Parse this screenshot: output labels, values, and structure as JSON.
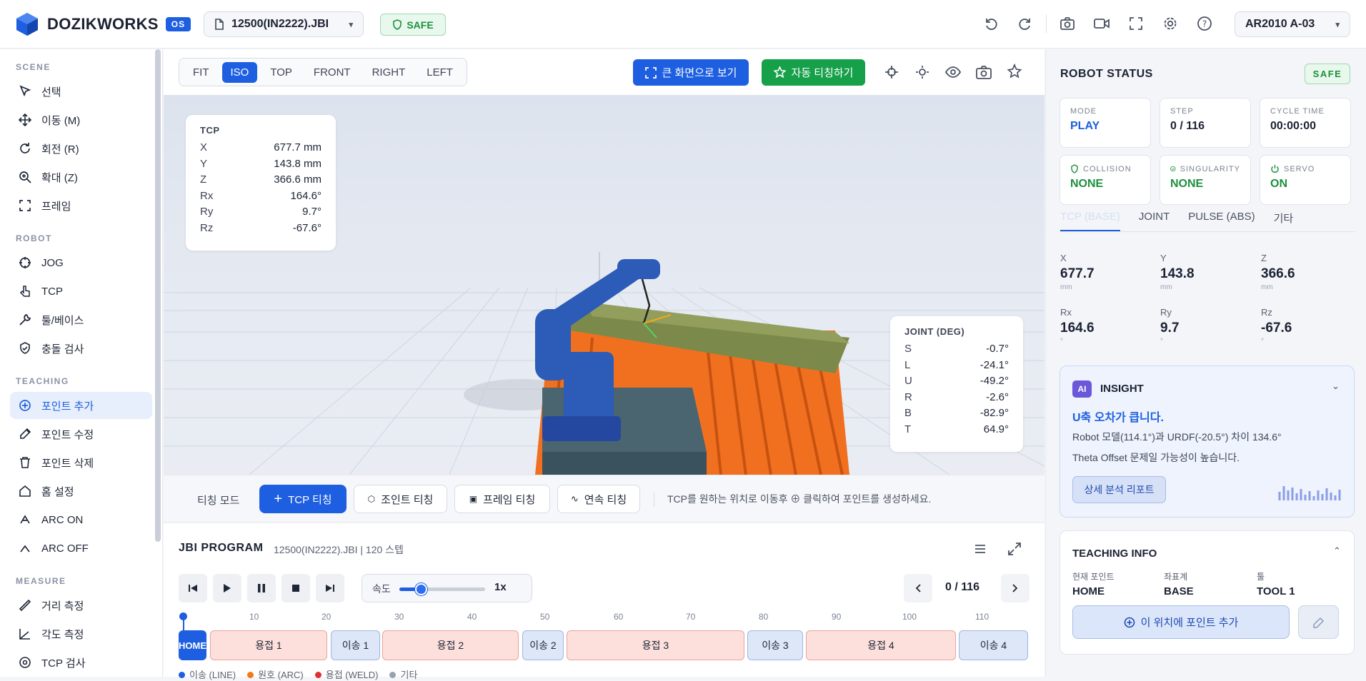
{
  "app": {
    "logo_text": "DOZIKWORKS",
    "os_badge": "OS",
    "file": "12500(IN2222).JBI",
    "safe": "SAFE",
    "robot": "AR2010 A-03"
  },
  "sidebar": {
    "scene_label": "SCENE",
    "scene": [
      "선택",
      "이동 (M)",
      "회전 (R)",
      "확대 (Z)",
      "프레임"
    ],
    "robot_label": "ROBOT",
    "robot": [
      "JOG",
      "TCP",
      "툴/베이스",
      "충돌 검사"
    ],
    "teaching_label": "TEACHING",
    "teaching": [
      "포인트 추가",
      "포인트 수정",
      "포인트 삭제",
      "홈 설정",
      "ARC ON",
      "ARC OFF"
    ],
    "measure_label": "MEASURE",
    "measure": [
      "거리 측정",
      "각도 측정",
      "TCP 검사"
    ]
  },
  "viewbar": {
    "tabs": [
      "FIT",
      "ISO",
      "TOP",
      "FRONT",
      "RIGHT",
      "LEFT"
    ],
    "active_tab": "ISO",
    "big_view": "큰 화면으로 보기",
    "auto_teach": "자동 티칭하기"
  },
  "tcp_panel": {
    "title": "TCP",
    "rows": [
      {
        "k": "X",
        "v": "677.7 mm"
      },
      {
        "k": "Y",
        "v": "143.8 mm"
      },
      {
        "k": "Z",
        "v": "366.6 mm"
      },
      {
        "k": "Rx",
        "v": "164.6°"
      },
      {
        "k": "Ry",
        "v": "9.7°"
      },
      {
        "k": "Rz",
        "v": "-67.6°"
      }
    ]
  },
  "joint_panel": {
    "title": "JOINT (DEG)",
    "rows": [
      {
        "k": "S",
        "v": "-0.7°"
      },
      {
        "k": "L",
        "v": "-24.1°"
      },
      {
        "k": "U",
        "v": "-49.2°"
      },
      {
        "k": "R",
        "v": "-2.6°"
      },
      {
        "k": "B",
        "v": "-82.9°"
      },
      {
        "k": "T",
        "v": "64.9°"
      }
    ]
  },
  "teachbar": {
    "mode_label": "티칭 모드",
    "tcp": "TCP 티칭",
    "joint": "조인트 티칭",
    "frame": "프레임 티칭",
    "continuous": "연속 티칭",
    "hint": "TCP를 원하는 위치로 이동후 ⊕ 클릭하여 포인트를 생성하세요."
  },
  "program": {
    "title": "JBI PROGRAM",
    "subtitle": "12500(IN2222).JBI | 120 스텝",
    "speed_label": "속도",
    "speed_value": "1x",
    "speed_fraction": 0.25,
    "step": "0 / 116",
    "ticks": [
      "10",
      "20",
      "30",
      "40",
      "50",
      "60",
      "70",
      "80",
      "90",
      "100",
      "110"
    ],
    "segments": [
      {
        "label": "HOME",
        "type": "home"
      },
      {
        "label": "용접 1",
        "type": "weld"
      },
      {
        "label": "이송 1",
        "type": "move"
      },
      {
        "label": "용접 2",
        "type": "weld"
      },
      {
        "label": "이송 2",
        "type": "move"
      },
      {
        "label": "용접 3",
        "type": "weld"
      },
      {
        "label": "이송 3",
        "type": "move"
      },
      {
        "label": "용접 4",
        "type": "weld"
      },
      {
        "label": "이송 4",
        "type": "move"
      }
    ],
    "legend": [
      {
        "label": "이송 (LINE)",
        "color": "#1d5fe0"
      },
      {
        "label": "원호 (ARC)",
        "color": "#f07a1a"
      },
      {
        "label": "용접 (WELD)",
        "color": "#e03131"
      },
      {
        "label": "기타",
        "color": "#9aa1ae"
      }
    ]
  },
  "status": {
    "title": "ROBOT STATUS",
    "safe": "SAFE",
    "cards": [
      {
        "label": "MODE",
        "value": "PLAY",
        "color": "#1d5fe0"
      },
      {
        "label": "STEP",
        "value": "0 / 116",
        "color": "#1b2233"
      },
      {
        "label": "CYCLE TIME",
        "value": "00:00:00",
        "color": "#1b2233"
      },
      {
        "label": "COLLISION",
        "value": "NONE",
        "color": "#1c8f3e"
      },
      {
        "label": "SINGULARITY",
        "value": "NONE",
        "color": "#1c8f3e"
      },
      {
        "label": "SERVO",
        "value": "ON",
        "color": "#1c8f3e"
      }
    ],
    "tabs": [
      "TCP (BASE)",
      "JOINT",
      "PULSE (ABS)",
      "기타"
    ],
    "coords": [
      {
        "k": "X",
        "v": "677.7",
        "u": "mm"
      },
      {
        "k": "Y",
        "v": "143.8",
        "u": "mm"
      },
      {
        "k": "Z",
        "v": "366.6",
        "u": "mm"
      },
      {
        "k": "Rx",
        "v": "164.6",
        "u": "°"
      },
      {
        "k": "Ry",
        "v": "9.7",
        "u": "°"
      },
      {
        "k": "Rz",
        "v": "-67.6",
        "u": "°"
      }
    ]
  },
  "insight": {
    "badge": "AI",
    "title": "INSIGHT",
    "headline": "U축 오차가 큽니다.",
    "line1": "Robot 모델(114.1°)과 URDF(-20.5°) 차이 134.6°",
    "line2": "Theta Offset 문제일 가능성이 높습니다.",
    "button": "상세 분석 리포트"
  },
  "teaching_info": {
    "title": "TEACHING INFO",
    "fields": [
      {
        "k": "현재 포인트",
        "v": "HOME"
      },
      {
        "k": "좌표계",
        "v": "BASE"
      },
      {
        "k": "툴",
        "v": "TOOL 1"
      }
    ],
    "add_button": "이 위치에 포인트 추가"
  }
}
